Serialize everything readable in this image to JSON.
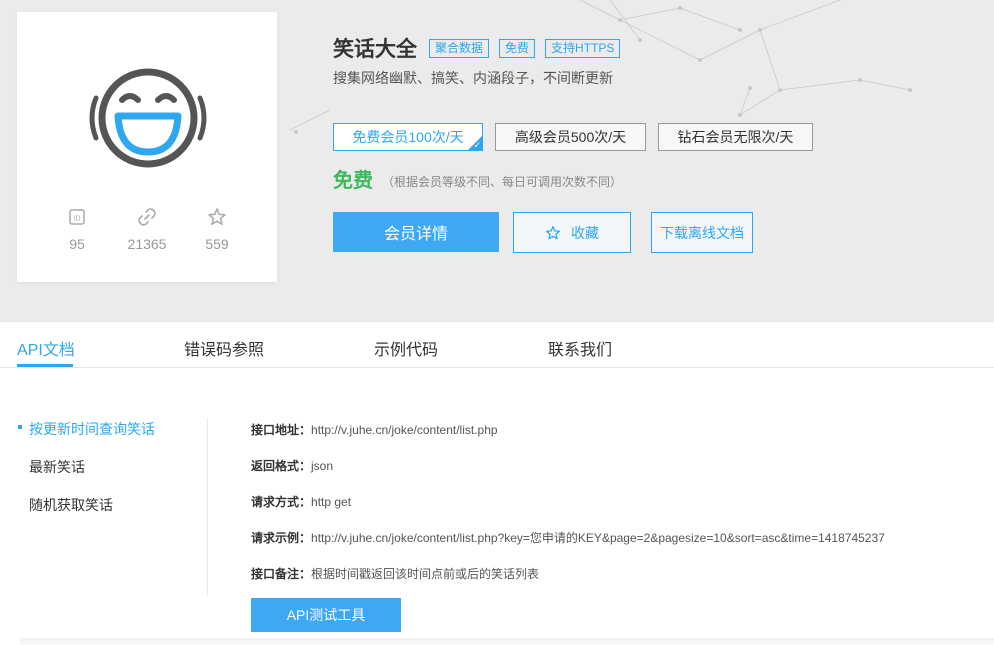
{
  "colors": {
    "accent": "#2ea7ee",
    "price_green": "#3fb85f",
    "hero_bg": "#ebebeb"
  },
  "api": {
    "title": "笑话大全",
    "tags": [
      "聚合数据",
      "免费",
      "支持HTTPS"
    ],
    "description": "搜集网络幽默、搞笑、内涵段子，不间断更新",
    "icon": "laughing-face-icon"
  },
  "stats": [
    {
      "icon": "id-icon",
      "value": "95"
    },
    {
      "icon": "link-icon",
      "value": "21365"
    },
    {
      "icon": "star-icon",
      "value": "559"
    }
  ],
  "plans": [
    {
      "label": "免费会员100次/天",
      "selected": true
    },
    {
      "label": "高级会员500次/天",
      "selected": false
    },
    {
      "label": "钻石会员无限次/天",
      "selected": false
    }
  ],
  "price": {
    "label": "免费",
    "note": "（根据会员等级不同、每日可调用次数不同）"
  },
  "actions": {
    "member_details": "会员详情",
    "favorite": "收藏",
    "download_doc": "下载离线文档"
  },
  "tabs": [
    "API文档",
    "错误码参照",
    "示例代码",
    "联系我们"
  ],
  "active_tab": "API文档",
  "sidebar": {
    "items": [
      "按更新时间查询笑话",
      "最新笑话",
      "随机获取笑话"
    ],
    "active": "按更新时间查询笑话"
  },
  "details": [
    {
      "key": "接口地址：",
      "value": "http://v.juhe.cn/joke/content/list.php"
    },
    {
      "key": "返回格式：",
      "value": "json"
    },
    {
      "key": "请求方式：",
      "value": "http get"
    },
    {
      "key": "请求示例：",
      "value": "http://v.juhe.cn/joke/content/list.php?key=您申请的KEY&page=2&pagesize=10&sort=asc&time=1418745237"
    },
    {
      "key": "接口备注：",
      "value": "根据时间戳返回该时间点前或后的笑话列表"
    }
  ],
  "api_test_button": "API测试工具"
}
